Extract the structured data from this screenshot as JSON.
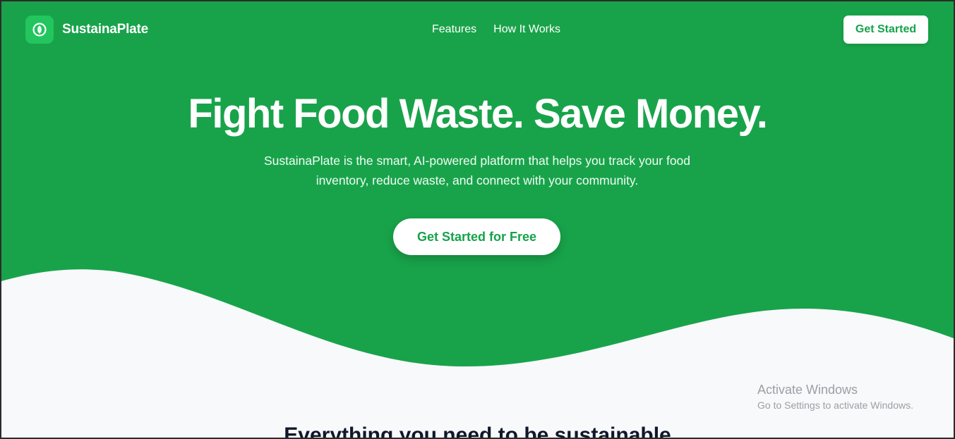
{
  "brand": {
    "name": "SustainaPlate",
    "logo_icon": "leaf-circle-icon",
    "primary_color": "#16a34a",
    "accent_color": "#22c55e"
  },
  "nav": {
    "links": [
      "Features",
      "How It Works"
    ],
    "cta_label": "Get Started"
  },
  "hero": {
    "headline": "Fight Food Waste. Save Money.",
    "subtitle": "SustainaPlate is the smart, AI-powered platform that helps you track your food inventory, reduce waste, and connect with your community.",
    "cta_label": "Get Started for Free"
  },
  "features_section": {
    "title": "Everything you need to be sustainable"
  },
  "os_watermark": {
    "title": "Activate Windows",
    "subtitle": "Go to Settings to activate Windows."
  }
}
